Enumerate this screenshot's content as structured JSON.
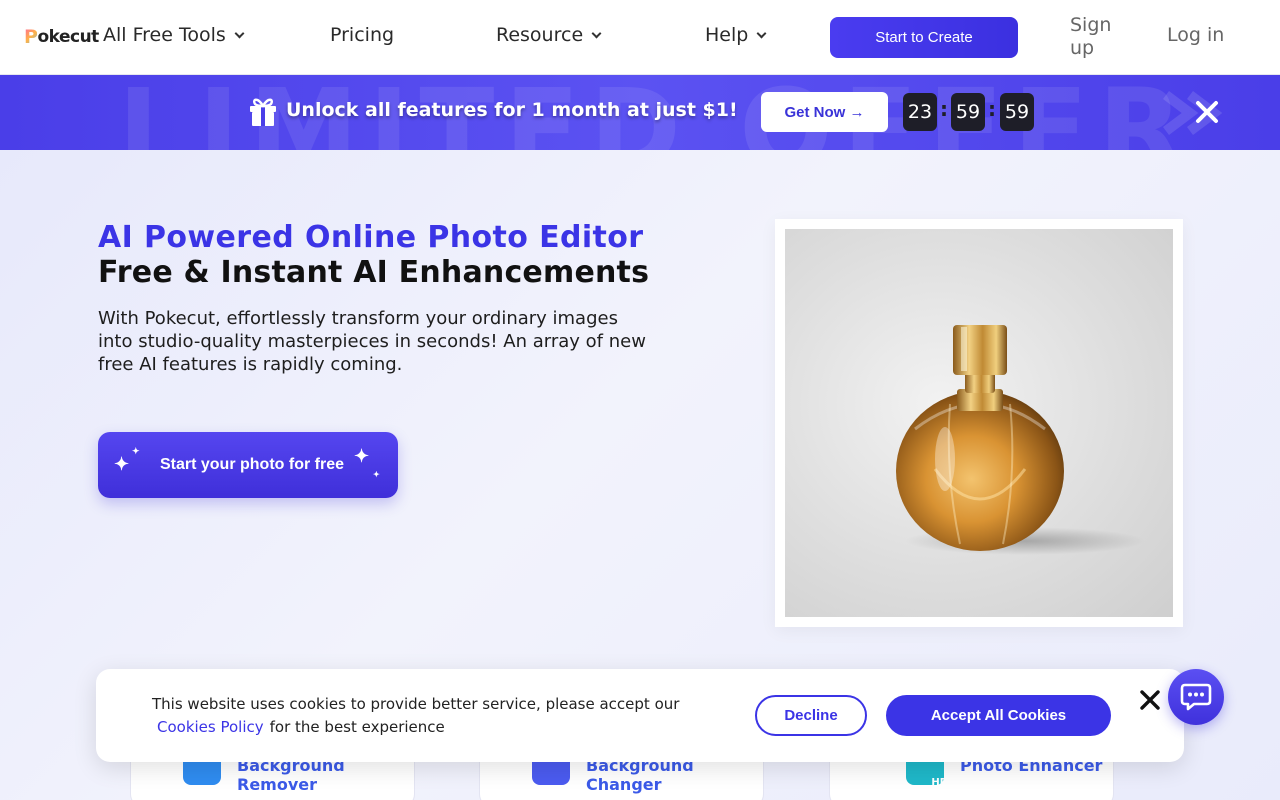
{
  "nav": {
    "logo_initial": "P",
    "logo_rest": "okecut",
    "items": [
      {
        "label": "All Free Tools",
        "has_dropdown": true
      },
      {
        "label": "Pricing",
        "has_dropdown": false
      },
      {
        "label": "Resource",
        "has_dropdown": true
      },
      {
        "label": "Help",
        "has_dropdown": true
      }
    ],
    "create_label": "Start to Create",
    "signup_label": "Sign up",
    "login_label": "Log in"
  },
  "promo": {
    "bg_text": "LIMITED OFFER",
    "text": "Unlock all features for 1 month at just $1!",
    "cta_label": "Get Now →",
    "timer": {
      "hours": "23",
      "minutes": "59",
      "seconds": "59",
      "separator": ":"
    },
    "icons": {
      "gift": "gift-icon",
      "close": "close-icon"
    }
  },
  "hero": {
    "title_line1": "AI Powered Online Photo Editor",
    "title_line2": "Free & Instant AI Enhancements",
    "description": "With Pokecut, effortlessly transform your ordinary images into studio-quality masterpieces in seconds! An array of new free AI features is rapidly coming.",
    "cta_label": "Start your photo for free",
    "image_subject": "perfume-bottle"
  },
  "tools": [
    {
      "label": "Background Remover",
      "icon": "background-remover-icon",
      "color": "#2f8cf0"
    },
    {
      "label": "Background Changer",
      "icon": "background-changer-icon",
      "color": "#4b5bf0"
    },
    {
      "label": "Photo Enhancer",
      "icon": "photo-enhancer-icon",
      "color": "#1fb8c9",
      "badge": "HD"
    }
  ],
  "cookie": {
    "text_before": "This website uses cookies to provide better service, please accept our",
    "link_label": "Cookies Policy",
    "text_after": "for the best experience",
    "decline_label": "Decline",
    "accept_label": "Accept All Cookies"
  },
  "colors": {
    "accent": "#3b34e6",
    "promo_bg": "#4a3ee8",
    "hero_bg": "#eef0fb",
    "timer_bg": "#1e1e28"
  }
}
